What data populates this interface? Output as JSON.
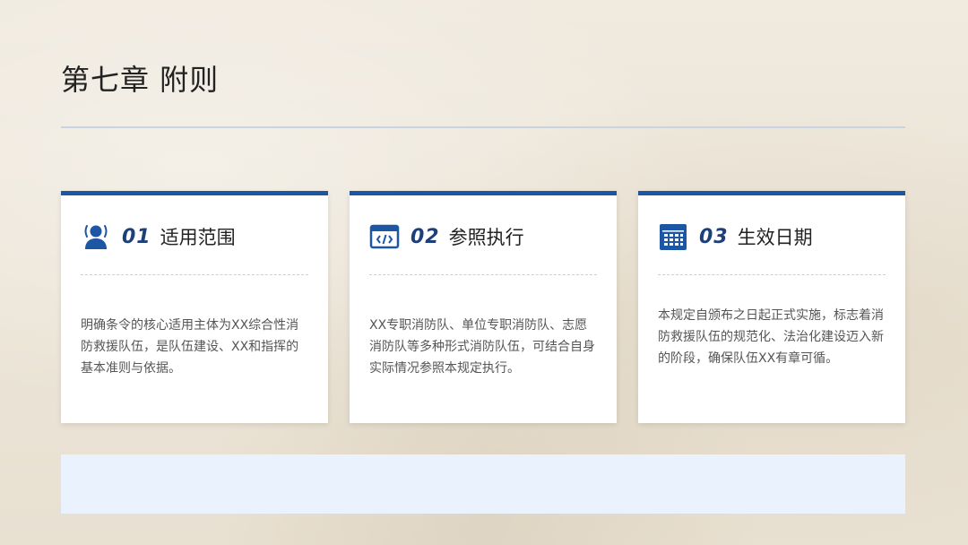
{
  "page": {
    "title": "第七章  附则"
  },
  "cards": [
    {
      "num": "01",
      "title": "适用范围",
      "icon": "person-icon",
      "body": "明确条令的核心适用主体为XX综合性消防救援队伍，是队伍建设、XX和指挥的基本准则与依据。"
    },
    {
      "num": "02",
      "title": "参照执行",
      "icon": "code-window-icon",
      "body": "XX专职消防队、单位专职消防队、志愿消防队等多种形式消防队伍，可结合自身实际情况参照本规定执行。"
    },
    {
      "num": "03",
      "title": "生效日期",
      "icon": "calendar-icon",
      "body": "本规定自颁布之日起正式实施，标志着消防救援队伍的规范化、法治化建设迈入新的阶段，确保队伍XX有章可循。"
    }
  ],
  "colors": {
    "accent": "#1d56a5",
    "number": "#1d3f7a",
    "banner": "#eaf3fd"
  }
}
